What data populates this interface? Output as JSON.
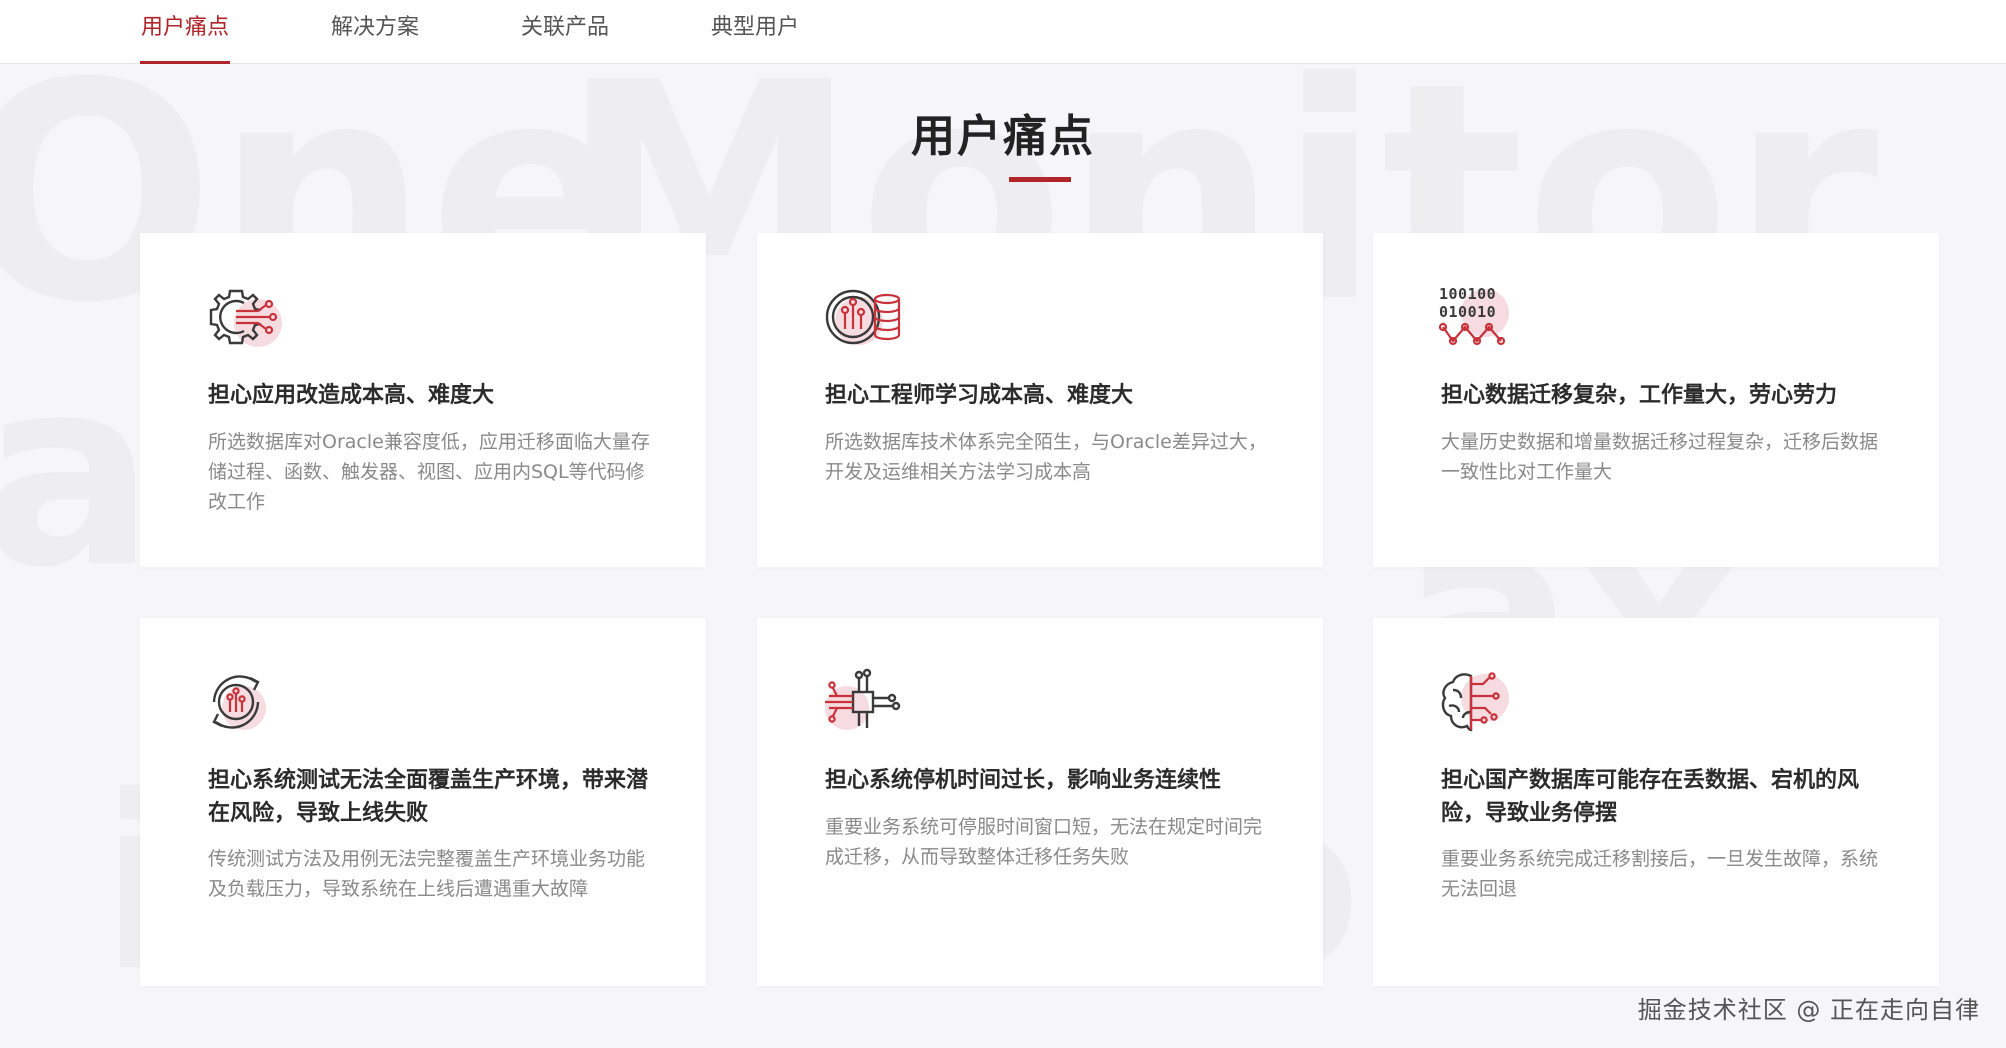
{
  "nav": {
    "tabs": [
      {
        "label": "用户痛点",
        "active": true
      },
      {
        "label": "解决方案",
        "active": false
      },
      {
        "label": "关联产品",
        "active": false
      },
      {
        "label": "典型用户",
        "active": false
      }
    ]
  },
  "section": {
    "title": "用户痛点"
  },
  "cards": [
    {
      "icon": "gear-circuit-icon",
      "title": "担心应用改造成本高、难度大",
      "description": "所选数据库对Oracle兼容度低，应用迁移面临大量存储过程、函数、触发器、视图、应用内SQL等代码修改工作"
    },
    {
      "icon": "coin-stack-circuit-icon",
      "title": "担心工程师学习成本高、难度大",
      "description": "所选数据库技术体系完全陌生，与Oracle差异过大，开发及运维相关方法学习成本高"
    },
    {
      "icon": "binary-data-icon",
      "title": "担心数据迁移复杂，工作量大，劳心劳力",
      "description": "大量历史数据和增量数据迁移过程复杂，迁移后数据一致性比对工作量大"
    },
    {
      "icon": "refresh-circuit-icon",
      "title": "担心系统测试无法全面覆盖生产环境，带来潜在风险，导致上线失败",
      "description": "传统测试方法及用例无法完整覆盖生产环境业务功能及负载压力，导致系统在上线后遭遇重大故障"
    },
    {
      "icon": "chip-icon",
      "title": "担心系统停机时间过长，影响业务连续性",
      "description": "重要业务系统可停服时间窗口短，无法在规定时间完成迁移，从而导致整体迁移任务失败"
    },
    {
      "icon": "brain-circuit-icon",
      "title": "担心国产数据库可能存在丢数据、宕机的风险，导致业务停摆",
      "description": "重要业务系统完成迁移割接后，一旦发生故障，系统无法回退"
    }
  ],
  "watermark": "掘金技术社区 @ 正在走向自律",
  "colors": {
    "accent": "#b0242a",
    "icon_pink": "#f6dbe0",
    "icon_dark": "#3a3a3a"
  }
}
